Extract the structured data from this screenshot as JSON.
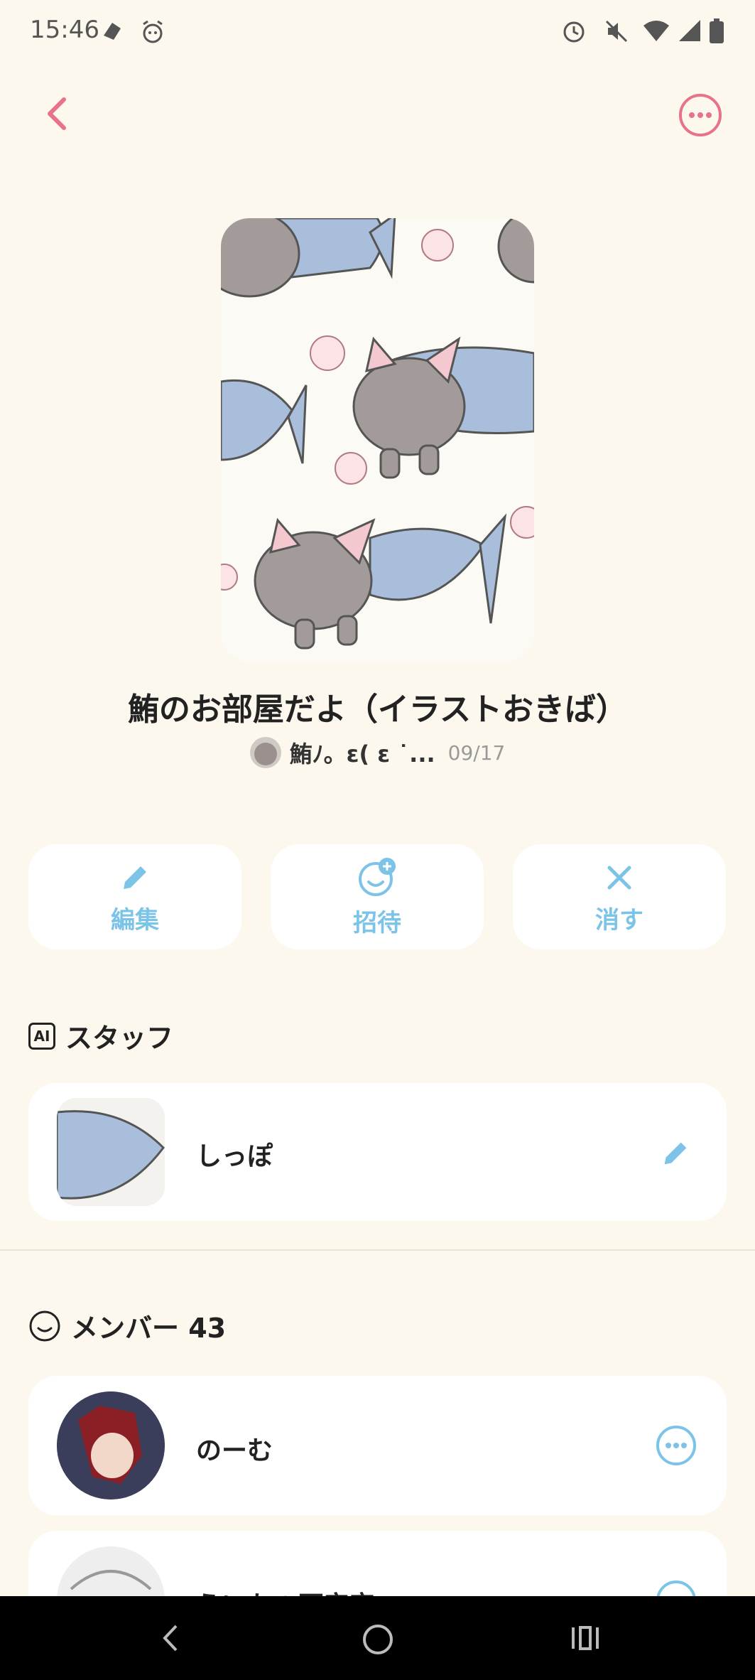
{
  "status_bar": {
    "time": "15:46",
    "left_icons": [
      "notification-icon",
      "alarm-clock-icon"
    ],
    "right_icons": [
      "alarm-icon",
      "mute-icon",
      "wifi-icon",
      "signal-icon",
      "battery-icon"
    ]
  },
  "header": {
    "back_icon": "chevron-left-icon",
    "more_icon": "more-horizontal-icon"
  },
  "room": {
    "title": "鮪のお部屋だよ（イラストおきば）",
    "owner_name": "鮪ﾉ。ε( ε ˙...",
    "date": "09/17"
  },
  "actions": [
    {
      "label": "編集",
      "icon": "pencil-icon"
    },
    {
      "label": "招待",
      "icon": "invite-face-plus-icon"
    },
    {
      "label": "消す",
      "icon": "close-x-icon"
    }
  ],
  "staff": {
    "heading": "スタッフ",
    "badge": "AI",
    "items": [
      {
        "name": "しっぽ",
        "action_icon": "pencil-icon"
      }
    ]
  },
  "members": {
    "heading": "メンバー 43",
    "items": [
      {
        "name": "のーむ",
        "action_icon": "more-circle-icon"
      },
      {
        "name": "ういか@不安定",
        "action_icon": "more-circle-icon"
      }
    ]
  },
  "nav_bar": {
    "icons": [
      "back-nav-icon",
      "home-nav-icon",
      "recents-nav-icon"
    ]
  },
  "colors": {
    "background": "#fdf8ee",
    "accent_pink": "#e8728a",
    "accent_blue": "#7cc3e8"
  }
}
